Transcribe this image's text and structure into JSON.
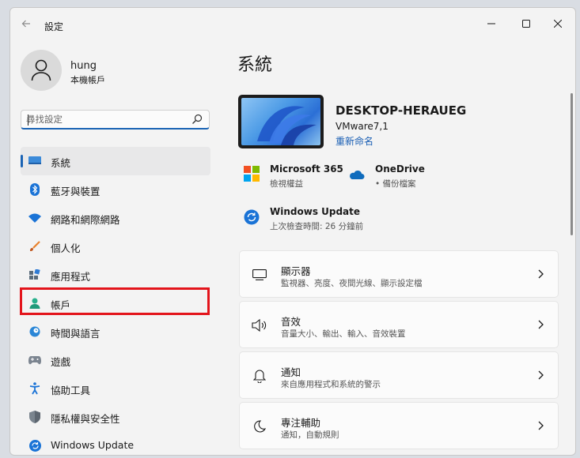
{
  "window": {
    "title": "設定"
  },
  "user": {
    "name": "hung",
    "account_type": "本機帳戶"
  },
  "search": {
    "placeholder": "尋找設定"
  },
  "nav": {
    "items": [
      {
        "label": "系統"
      },
      {
        "label": "藍牙與裝置"
      },
      {
        "label": "網路和網際網路"
      },
      {
        "label": "個人化"
      },
      {
        "label": "應用程式"
      },
      {
        "label": "帳戶"
      },
      {
        "label": "時間與語言"
      },
      {
        "label": "遊戲"
      },
      {
        "label": "協助工具"
      },
      {
        "label": "隱私權與安全性"
      },
      {
        "label": "Windows Update"
      }
    ]
  },
  "main": {
    "title": "系統",
    "device": {
      "name": "DESKTOP-HERAUEG",
      "model": "VMware7,1",
      "rename": "重新命名"
    },
    "quick": [
      {
        "title": "Microsoft 365",
        "sub": "檢視權益"
      },
      {
        "title": "OneDrive",
        "sub": "• 備份檔案"
      },
      {
        "title": "Windows Update",
        "sub": "上次檢查時間: 26 分鐘前"
      }
    ],
    "cards": [
      {
        "title": "顯示器",
        "sub": "監視器、亮度、夜間光線、顯示設定檔"
      },
      {
        "title": "音效",
        "sub": "音量大小、輸出、輸入、音效裝置"
      },
      {
        "title": "通知",
        "sub": "來自應用程式和系統的警示"
      },
      {
        "title": "專注輔助",
        "sub": "通知，自動規則"
      }
    ]
  },
  "colors": {
    "accent": "#1a63b4",
    "highlight": "#e3141b",
    "background": "#f3f3f3"
  }
}
